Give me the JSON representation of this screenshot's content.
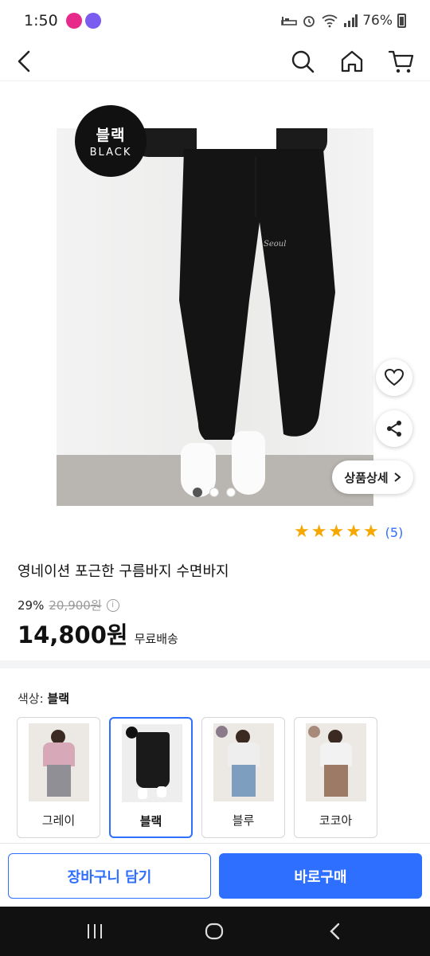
{
  "status": {
    "time": "1:50",
    "battery": "76%",
    "app_icons": [
      {
        "name": "gmarket-icon",
        "color": "#e8298c"
      },
      {
        "name": "kakaotalk-icon",
        "color": "#7a5cf0"
      }
    ]
  },
  "product": {
    "badge": {
      "ko": "블랙",
      "en": "BLACK"
    },
    "title": "영네이션 포근한 구름바지 수면바지",
    "rating": {
      "stars": 5,
      "count": "(5)"
    },
    "discount": "29%",
    "original_price": "20,900원",
    "sale_price": "14,800원",
    "shipping": "무료배송",
    "detail_button": "상품상세",
    "gallery": {
      "total": 3,
      "current": 1
    }
  },
  "options": {
    "label": "색상:",
    "selected": "블랙",
    "colors": [
      {
        "label": "그레이",
        "pants_color": "#8f8f95",
        "top_color": "#d7a9b8",
        "selected": false
      },
      {
        "label": "블랙",
        "pants_color": "#1a1a1a",
        "top_color": "#ffffff",
        "selected": true
      },
      {
        "label": "블루",
        "pants_color": "#7e9ec0",
        "top_color": "#eeeeee",
        "selected": false
      },
      {
        "label": "코코아",
        "pants_color": "#9c7a66",
        "top_color": "#f2f2f2",
        "selected": false
      }
    ]
  },
  "actions": {
    "cart": "장바구니 담기",
    "buy": "바로구매"
  },
  "colors": {
    "accent": "#2f6fff",
    "star": "#f6a700"
  }
}
